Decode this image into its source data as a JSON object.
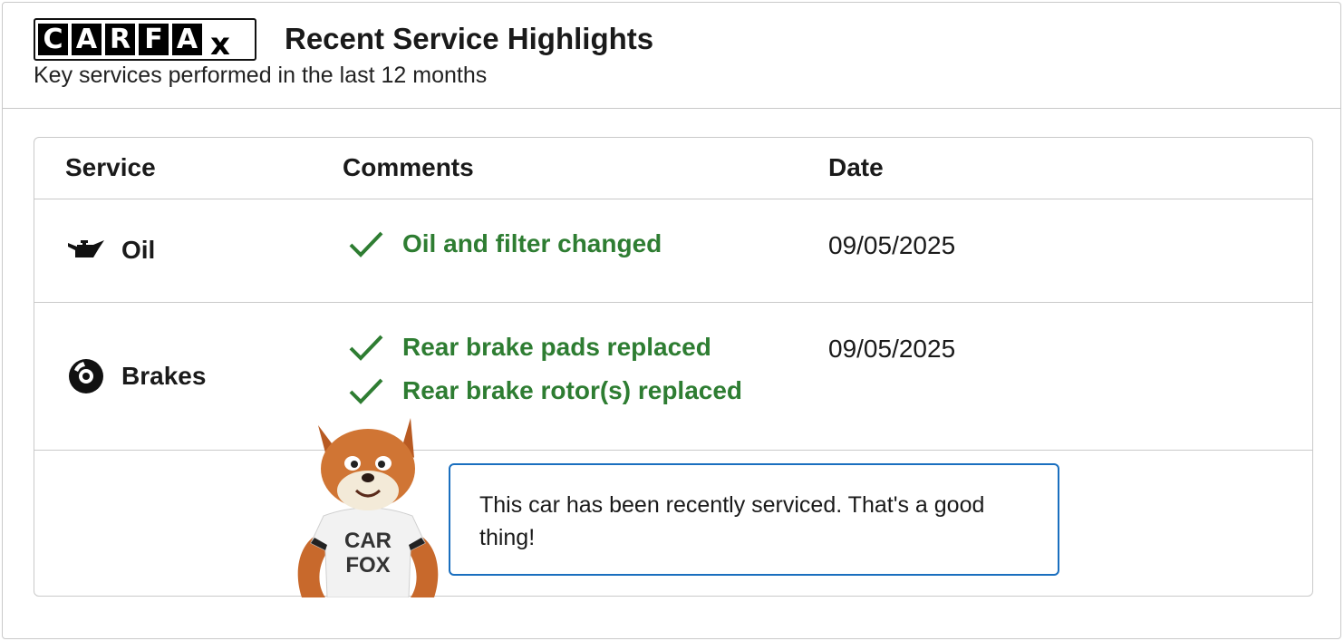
{
  "header": {
    "logo_letters": [
      "C",
      "A",
      "R",
      "F",
      "A"
    ],
    "logo_suffix": "x",
    "title": "Recent Service Highlights",
    "subtitle": "Key services performed in the last 12 months"
  },
  "table": {
    "columns": [
      "Service",
      "Comments",
      "Date"
    ],
    "rows": [
      {
        "service": "Oil",
        "icon": "oil-can-icon",
        "comments": [
          "Oil and filter changed"
        ],
        "date": "09/05/2025"
      },
      {
        "service": "Brakes",
        "icon": "brake-disc-icon",
        "comments": [
          "Rear brake pads replaced",
          "Rear brake rotor(s) replaced"
        ],
        "date": "09/05/2025"
      }
    ]
  },
  "mascot": {
    "shirt_text": [
      "CAR",
      "FOX"
    ]
  },
  "callout": {
    "message": "This car has been recently serviced. That's a good thing!"
  },
  "colors": {
    "comment_green": "#2e7d32",
    "callout_border": "#1a6fbf",
    "divider": "#c9c9c9"
  }
}
